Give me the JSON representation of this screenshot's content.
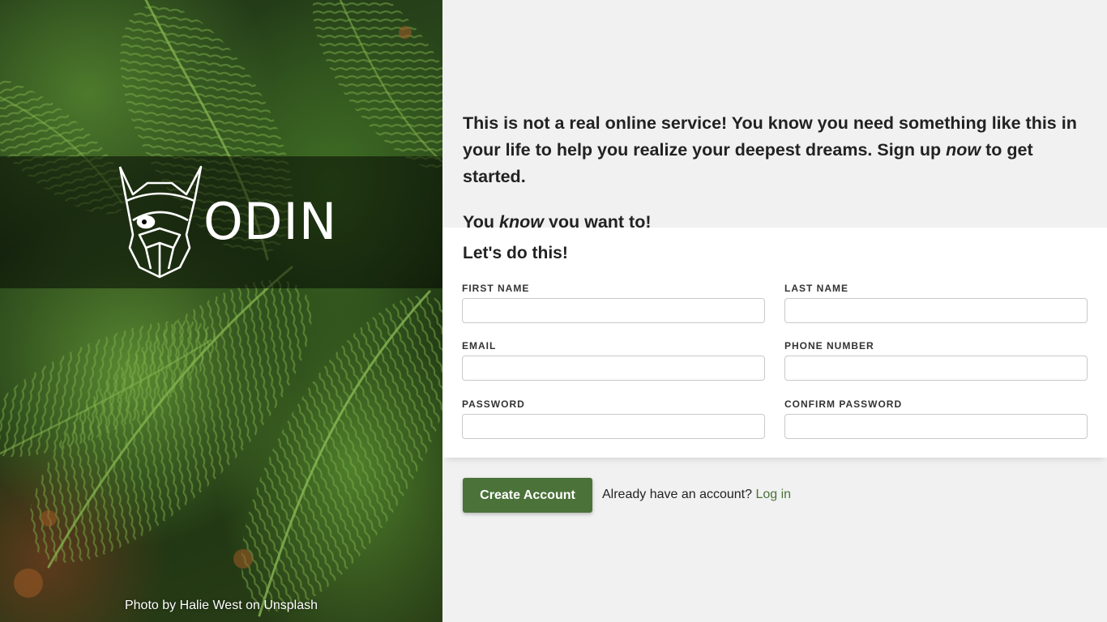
{
  "hero": {
    "brand_name": "ODIN",
    "logo_icon": "viking-helmet-icon",
    "photo_credit": "Photo by Halie West on Unsplash"
  },
  "intro": {
    "line1_pre": "This is not a real online service! You know you need something like this in your life to help you realize your deepest dreams. Sign up ",
    "line1_em": "now",
    "line1_post": " to get started.",
    "line2_pre": "You ",
    "line2_em": "know",
    "line2_post": " you want to!"
  },
  "form": {
    "title": "Let's do this!",
    "fields": {
      "first_name": {
        "label": "FIRST NAME",
        "value": "",
        "placeholder": ""
      },
      "last_name": {
        "label": "LAST NAME",
        "value": "",
        "placeholder": ""
      },
      "email": {
        "label": "EMAIL",
        "value": "",
        "placeholder": ""
      },
      "phone": {
        "label": "PHONE NUMBER",
        "value": "",
        "placeholder": ""
      },
      "password": {
        "label": "PASSWORD",
        "value": "",
        "placeholder": ""
      },
      "confirm_password": {
        "label": "CONFIRM PASSWORD",
        "value": "",
        "placeholder": ""
      }
    }
  },
  "actions": {
    "create_label": "Create Account",
    "login_prompt": "Already have an account?",
    "login_link": "Log in"
  },
  "colors": {
    "accent": "#4a7239",
    "background": "#f1f1f1",
    "card": "#ffffff"
  }
}
